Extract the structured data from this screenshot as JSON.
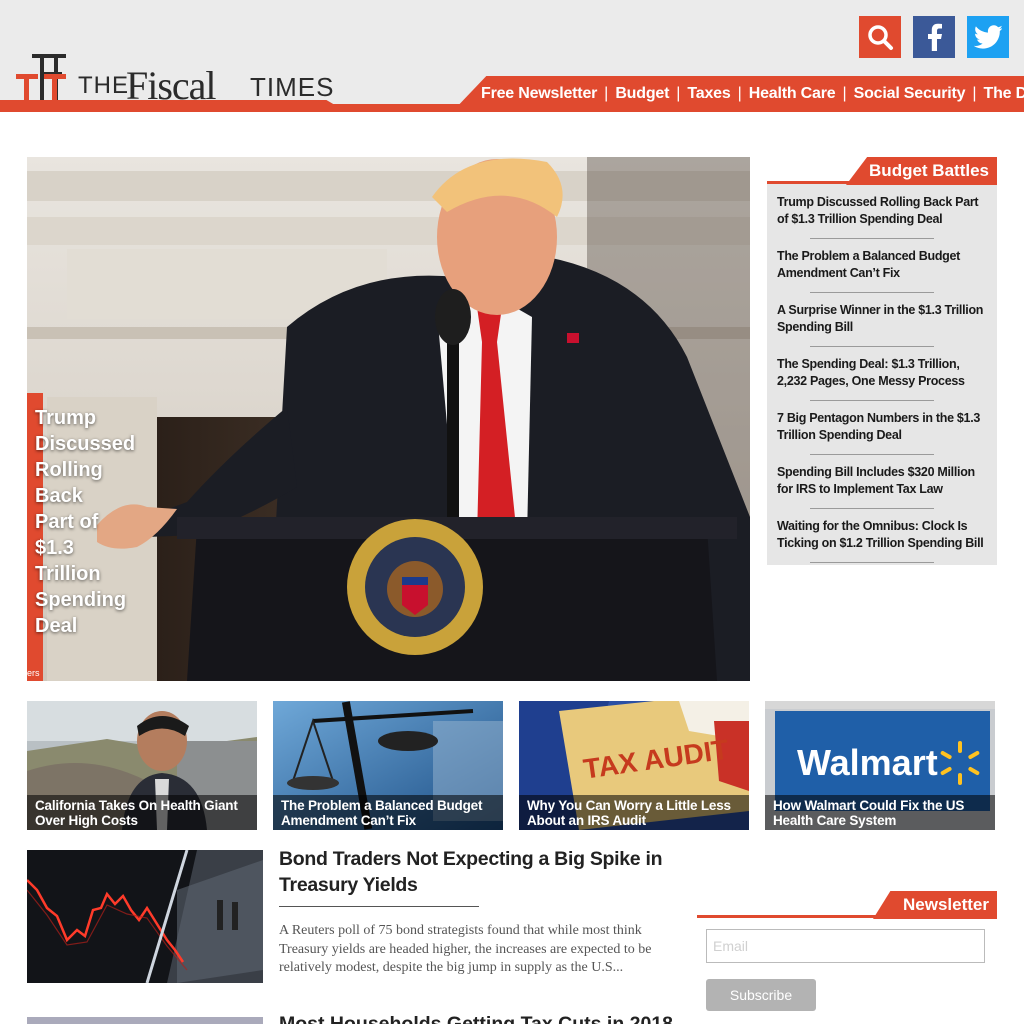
{
  "brand": {
    "the": "THE",
    "fiscal": "Fiscal",
    "times": "TIMES",
    "accent": "#e04a2f"
  },
  "social": [
    {
      "name": "search-icon",
      "color": "#e04a2f"
    },
    {
      "name": "facebook-icon",
      "color": "#3b5998"
    },
    {
      "name": "twitter-icon",
      "color": "#1da1f2"
    }
  ],
  "nav": {
    "items": [
      "Free Newsletter",
      "Budget",
      "Taxes",
      "Health Care",
      "Social Security",
      "The Debt"
    ],
    "separator": "|"
  },
  "hero": {
    "caption": "Trump Discussed Rolling Back Part of $1.3 Trillion Spending Deal",
    "credit": "ers"
  },
  "sidebar": {
    "title": "Budget Battles",
    "items": [
      "Trump Discussed Rolling Back Part of $1.3 Trillion Spending Deal",
      "The Problem a Balanced Budget Amendment Can’t Fix",
      "A Surprise Winner in the $1.3 Trillion Spending Bill",
      "The Spending Deal: $1.3 Trillion, 2,232 Pages, One Messy Process",
      "7 Big Pentagon Numbers in the $1.3 Trillion Spending Deal",
      "Spending Bill Includes $320 Million for IRS to Implement Tax Law",
      "Waiting for the Omnibus: Clock Is Ticking on $1.2 Trillion Spending Bill"
    ]
  },
  "tiles": [
    {
      "caption": "California Takes On Health Giant Over High Costs"
    },
    {
      "caption": "The Problem a Balanced Budget Amendment Can’t Fix"
    },
    {
      "caption": "Why You Can Worry a Little Less About an IRS Audit",
      "image_text": "TAX AUDIT"
    },
    {
      "caption": "How Walmart Could Fix the US Health Care System",
      "image_text": "Walmart"
    }
  ],
  "articles": [
    {
      "title": "Bond Traders Not Expecting a Big Spike in Treasury Yields",
      "summary": "A Reuters poll of 75 bond strategists found that while most think Treasury yields are headed higher, the increases are expected to be relatively modest, despite the big jump in supply as the U.S..."
    },
    {
      "title": "Most Households Getting Tax Cuts in 2018"
    }
  ],
  "newsletter": {
    "title": "Newsletter",
    "placeholder": "Email",
    "button": "Subscribe"
  }
}
